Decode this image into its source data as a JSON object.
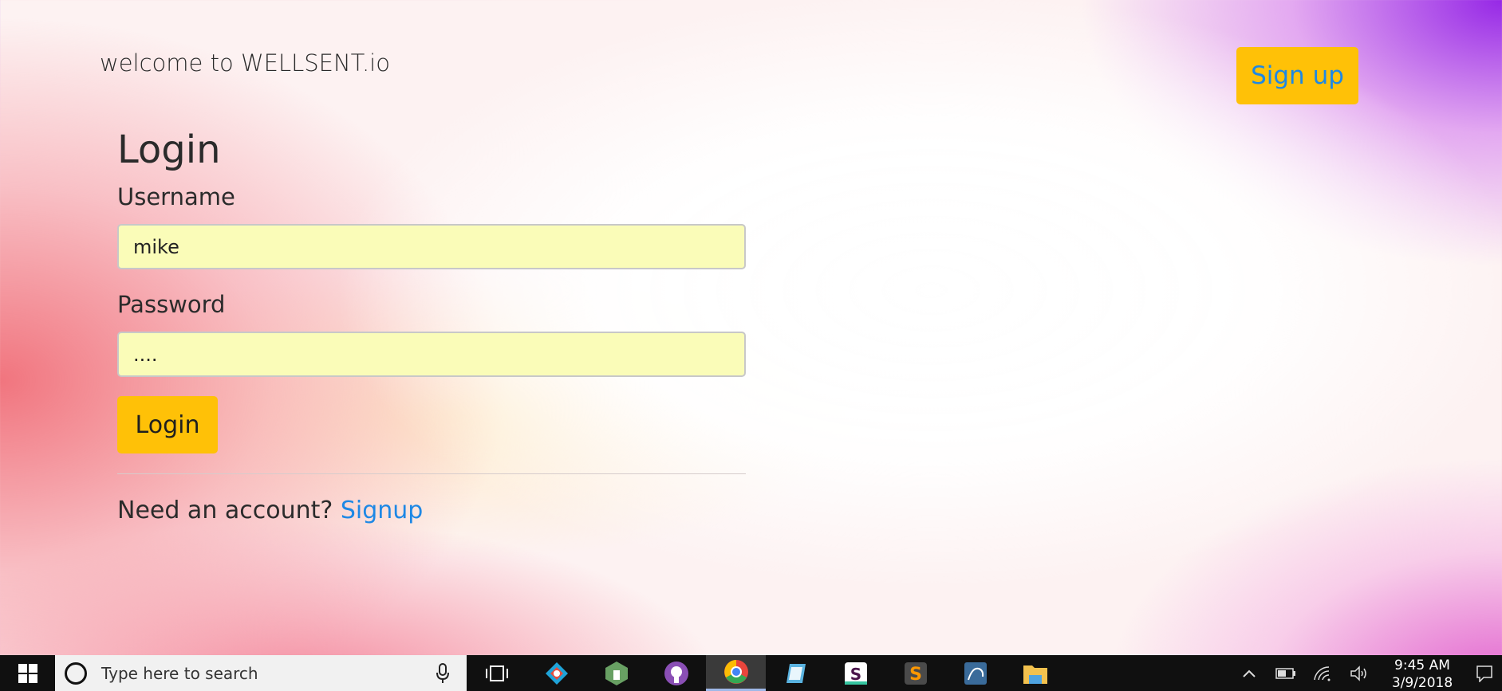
{
  "header": {
    "brand": "welcome to WELLSENT.io",
    "signup_button": "Sign up"
  },
  "login_form": {
    "title": "Login",
    "username_label": "Username",
    "username_value": "mike",
    "password_label": "Password",
    "password_value": "....",
    "submit_label": "Login",
    "account_prompt": "Need an account? ",
    "signup_link": "Signup"
  },
  "taskbar": {
    "search_placeholder": "Type here to search",
    "apps": [
      {
        "name": "task-view",
        "color": "#101010"
      },
      {
        "name": "gitkraken",
        "color": "#1fa3d8"
      },
      {
        "name": "nodejs",
        "color": "#68a063"
      },
      {
        "name": "github",
        "color": "#8a4fb5"
      },
      {
        "name": "chrome",
        "color": "#e8453c"
      },
      {
        "name": "notepad",
        "color": "#5ab3e0"
      },
      {
        "name": "slack",
        "color": "#ffffff"
      },
      {
        "name": "sublime",
        "color": "#ff9800"
      },
      {
        "name": "mysql",
        "color": "#3a6b9a"
      },
      {
        "name": "file-explorer",
        "color": "#f2c14e"
      }
    ],
    "clock_time": "9:45 AM",
    "clock_date": "3/9/2018"
  },
  "colors": {
    "accent_yellow": "#ffc107",
    "link_blue": "#1e88e5",
    "input_fill": "#fafcb8"
  }
}
